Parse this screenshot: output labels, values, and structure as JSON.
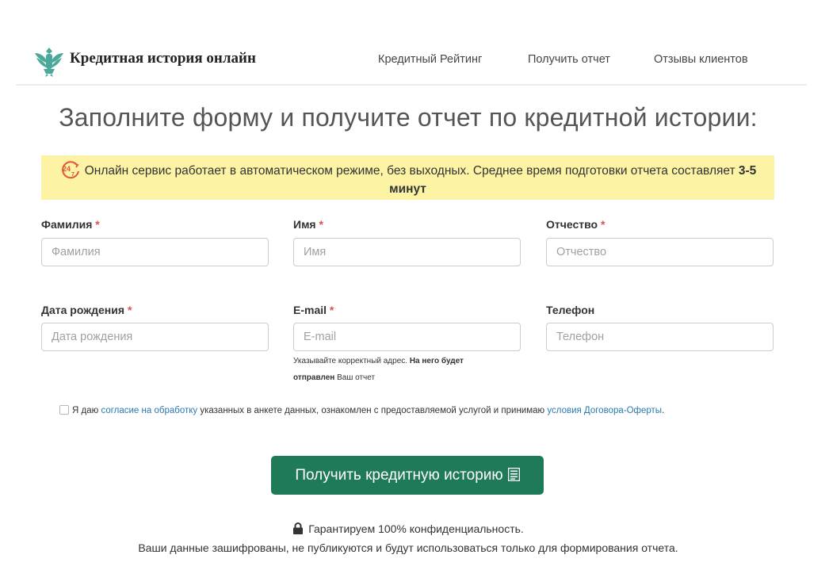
{
  "header": {
    "brand": "Кредитная история онлайн",
    "nav": [
      {
        "label": "Кредитный Рейтинг"
      },
      {
        "label": "Получить отчет"
      },
      {
        "label": "Отзывы клиентов"
      }
    ]
  },
  "page_title": "Заполните форму и получите отчет по кредитной истории:",
  "notice": {
    "icon": "24-7-icon",
    "text": "Онлайн сервис работает в автоматическом режиме, без выходных. Среднее время подготовки отчета составляет ",
    "highlight": "3-5 минут"
  },
  "form": {
    "required_mark": "*",
    "last_name": {
      "label": "Фамилия",
      "placeholder": "Фамилия",
      "value": ""
    },
    "first_name": {
      "label": "Имя",
      "placeholder": "Имя",
      "value": ""
    },
    "middle_name": {
      "label": "Отчество",
      "placeholder": "Отчество",
      "value": ""
    },
    "birth_date": {
      "label": "Дата рождения",
      "placeholder": "Дата рождения",
      "value": ""
    },
    "email": {
      "label": "E-mail",
      "placeholder": "E-mail",
      "value": "",
      "hint_prefix": "Указывайте корректный адрес. ",
      "hint_bold": "На него будет отправлен",
      "hint_suffix": " Ваш отчет"
    },
    "phone": {
      "label": "Телефон",
      "placeholder": "Телефон",
      "value": ""
    }
  },
  "consent": {
    "checked": false,
    "text1": "Я даю ",
    "link1": "согласие на обработку",
    "text2": " указанных в анкете данных, ознакомлен с предоставляемой услугой и принимаю ",
    "link2": "условия Договора-Оферты",
    "text3": "."
  },
  "submit": {
    "label": "Получить кредитную историю",
    "icon": "list-icon"
  },
  "privacy": {
    "icon": "lock-icon",
    "line1": "Гарантируем 100% конфиденциальность.",
    "line2": "Ваши данные зашифрованы, не публикуются и будут использоваться только для формирования отчета."
  },
  "colors": {
    "accent_green": "#1f7a57",
    "notice_yellow": "#fcf3a5",
    "required_red": "#d9534f",
    "link_blue": "#2a7ab0",
    "logo_teal": "#4aa99a"
  }
}
